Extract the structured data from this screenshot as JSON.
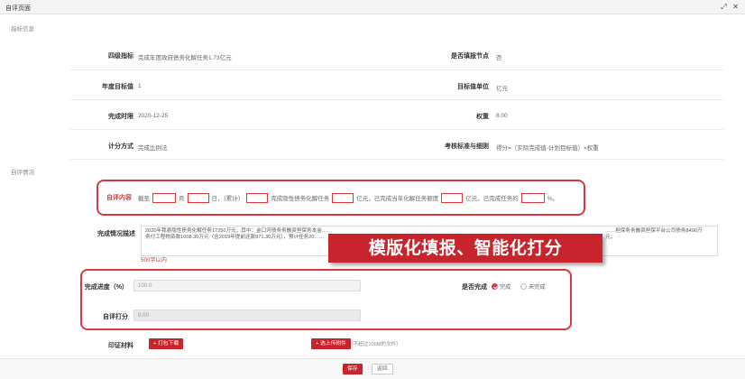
{
  "window": {
    "title": "自评页面",
    "icons": [
      "expand-icon",
      "close-icon"
    ]
  },
  "sections": {
    "indicator_info": "指标信息",
    "self_eval": "自评情况"
  },
  "fields": {
    "indicator_name": {
      "label": "四级指标",
      "value": "完成年度政府债务化解任务1.73亿元"
    },
    "is_milestone": {
      "label": "是否填报节点",
      "value": "否"
    },
    "annual_target": {
      "label": "年度目标值",
      "value": "1"
    },
    "target_unit": {
      "label": "目标值单位",
      "value": "亿元"
    },
    "completion_time": {
      "label": "完成时限",
      "value": "2020-12-25"
    },
    "weight": {
      "label": "权重",
      "value": "8.00"
    },
    "scoring_method": {
      "label": "计分方式",
      "value": "完成比例法"
    },
    "scoring_rule": {
      "label": "考核标准与细则",
      "value": "得分=（实际完成值-计划目标值）×权重"
    }
  },
  "self_content": {
    "label": "自评内容",
    "parts": [
      "截至",
      "月",
      "日，（累计）",
      "完成隐性债务化解任务",
      "亿元，已完成当年化解任务额度",
      "亿元，已完成任务的",
      "%。"
    ]
  },
  "completion_desc": {
    "label": "完成情况描述",
    "text_left": "2020年我县隐性债务化解任务17250万元，其中：金口河债务务融资担保务本金……",
    "text_left_2": "务付工程物资款1008.30万元（含2019年提前还款971.30万元），预计任务20……",
    "text_right": "……担保务务融资担保平台公司债务8490万元；",
    "limit_note": "500字以内"
  },
  "banner": "模版化填报、智能化打分",
  "progress": {
    "label": "完成进度（%）",
    "value": "100.0"
  },
  "is_complete": {
    "label": "是否完成",
    "options": [
      "完成",
      "未完成"
    ],
    "selected": 0
  },
  "self_score": {
    "label": "自评打分",
    "value": "8.00"
  },
  "evidence": {
    "label": "印证材料",
    "download_btn": "+ 打包下载",
    "upload_btn": "+ 选上传附件",
    "hint": "（不超过100M的文件）"
  },
  "footer": {
    "save": "保存",
    "back": "返回"
  },
  "colors": {
    "accent": "#c8242c",
    "highlight_border": "#d9393e"
  }
}
